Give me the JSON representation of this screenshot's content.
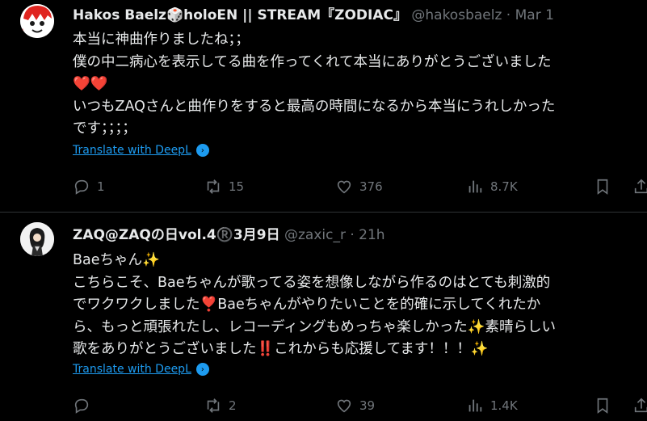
{
  "posts": [
    {
      "author": {
        "name": "Hakos Baelz🎲holoEN || STREAM『ZODIAC』",
        "handle": "@hakosbaelz",
        "separator": "·",
        "time": "Mar 1"
      },
      "lines": [
        "本当に神曲作りましたね；；",
        "僕の中二病心を表示してる曲を作ってくれて本当にありがとうございました",
        "❤️❤️",
        "いつもZAQさんと曲作りをすると最高の時間になるから本当にうれしかった",
        "です；；；；"
      ],
      "translate_label": "Translate with DeepL",
      "stats": {
        "replies": "1",
        "reposts": "15",
        "likes": "376",
        "views": "8.7K"
      }
    },
    {
      "author": {
        "name": "ZAQ@ZAQの日vol.4®️3月9日",
        "handle": "@zaxic_r",
        "separator": "·",
        "time": "21h"
      },
      "lines": [
        "Baeちゃん✨",
        "こちらこそ、Baeちゃんが歌ってる姿を想像しながら作るのはとても刺激的",
        "でワクワクしました❣️Baeちゃんがやりたいことを的確に示してくれたか",
        "ら、もっと頑張れたし、レコーディングもめっちゃ楽しかった✨素晴らしい",
        "歌をありがとうございました‼️これからも応援してます！！！✨"
      ],
      "translate_label": "Translate with DeepL",
      "stats": {
        "replies": "",
        "reposts": "2",
        "likes": "39",
        "views": "1.4K"
      }
    }
  ],
  "icons": {
    "reply": "reply-icon",
    "repost": "repost-icon",
    "like": "heart-icon",
    "views": "views-icon",
    "bookmark": "bookmark-icon",
    "share": "share-icon",
    "deepl": "deepl-icon"
  },
  "colors": {
    "background": "#000000",
    "text": "#e7e9ea",
    "muted": "#71767b",
    "link": "#1d9bf0",
    "divider": "#2f3336"
  }
}
